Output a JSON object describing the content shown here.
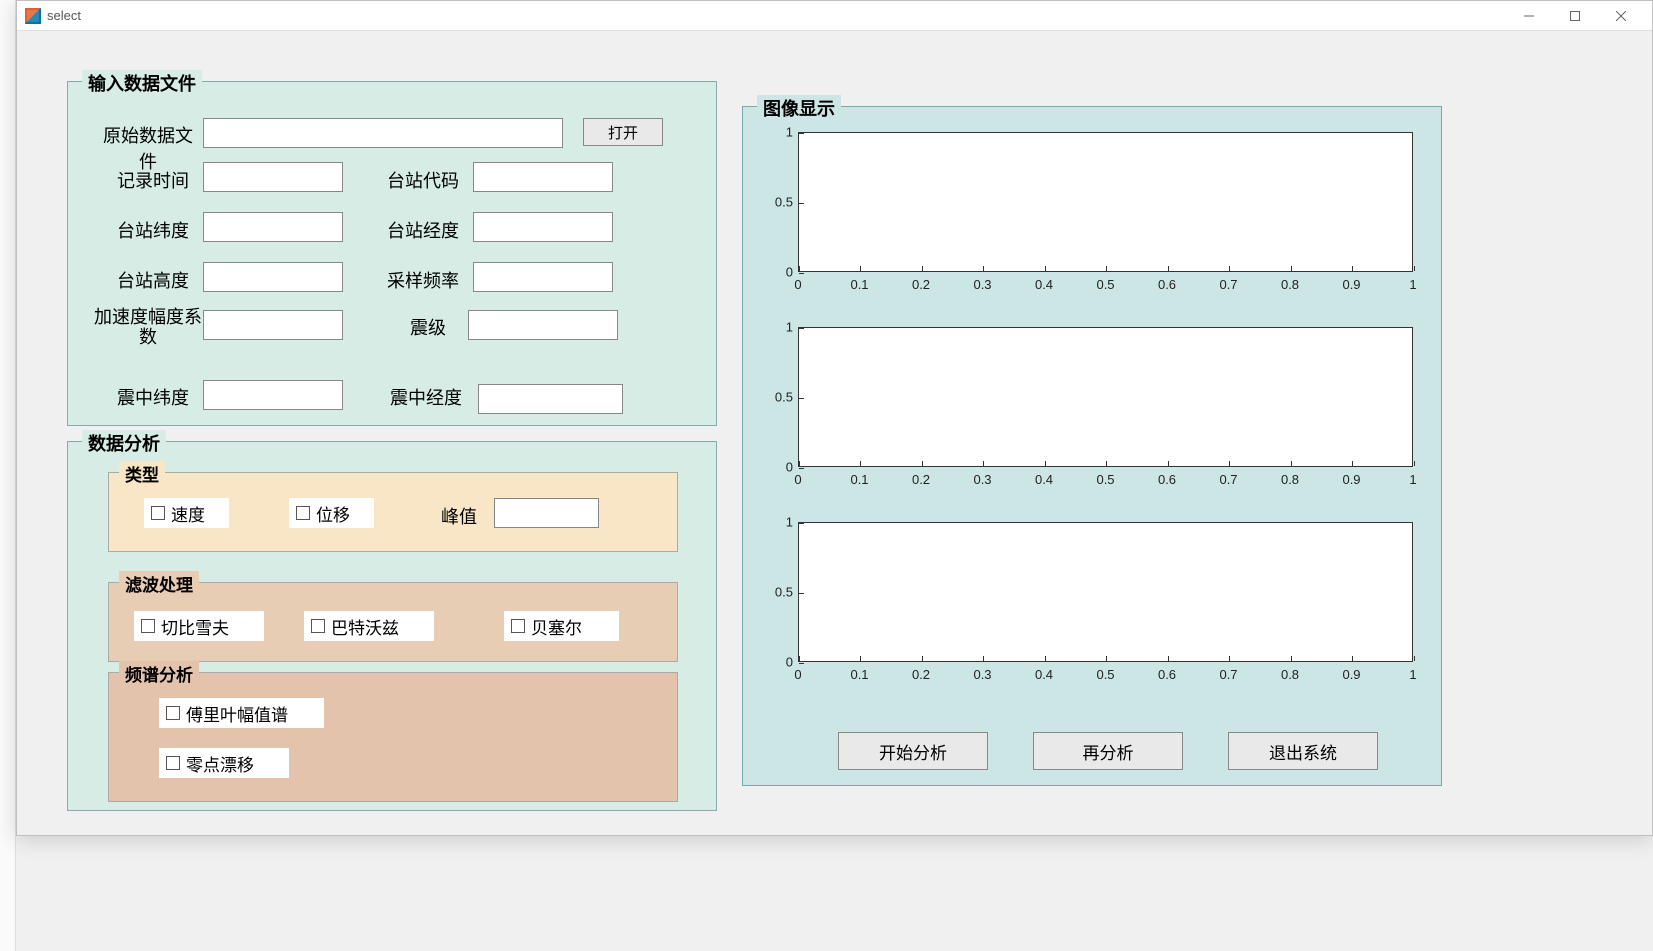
{
  "window": {
    "title": "select"
  },
  "panels": {
    "input_legend": "输入数据文件",
    "analysis_legend": "数据分析",
    "image_legend": "图像显示"
  },
  "input": {
    "raw_file_label": "原始数据文件",
    "raw_file_value": "",
    "open_btn": "打开",
    "record_time_label": "记录时间",
    "record_time_value": "",
    "station_code_label": "台站代码",
    "station_code_value": "",
    "station_lat_label": "台站纬度",
    "station_lat_value": "",
    "station_lon_label": "台站经度",
    "station_lon_value": "",
    "station_alt_label": "台站高度",
    "station_alt_value": "",
    "sample_freq_label": "采样频率",
    "sample_freq_value": "",
    "accel_coef_label": "加速度幅度系数",
    "accel_coef_value": "",
    "magnitude_label": "震级",
    "magnitude_value": "",
    "epi_lat_label": "震中纬度",
    "epi_lat_value": "",
    "epi_lon_label": "震中经度",
    "epi_lon_value": ""
  },
  "analysis": {
    "type_legend": "类型",
    "chk_velocity": "速度",
    "chk_displacement": "位移",
    "peak_label": "峰值",
    "peak_value": "",
    "filter_legend": "滤波处理",
    "chk_chebyshev": "切比雪夫",
    "chk_butterworth": "巴特沃兹",
    "chk_bessel": "贝塞尔",
    "spectrum_legend": "频谱分析",
    "chk_fourier": "傅里叶幅值谱",
    "chk_zerodrift": "零点漂移"
  },
  "actions": {
    "start": "开始分析",
    "reanalyze": "再分析",
    "exit": "退出系统"
  },
  "chart_data": [
    {
      "type": "line",
      "series": [],
      "xlim": [
        0,
        1
      ],
      "ylim": [
        0,
        1
      ],
      "xticks": [
        0,
        0.1,
        0.2,
        0.3,
        0.4,
        0.5,
        0.6,
        0.7,
        0.8,
        0.9,
        1
      ],
      "yticks": [
        0,
        0.5,
        1
      ]
    },
    {
      "type": "line",
      "series": [],
      "xlim": [
        0,
        1
      ],
      "ylim": [
        0,
        1
      ],
      "xticks": [
        0,
        0.1,
        0.2,
        0.3,
        0.4,
        0.5,
        0.6,
        0.7,
        0.8,
        0.9,
        1
      ],
      "yticks": [
        0,
        0.5,
        1
      ]
    },
    {
      "type": "line",
      "series": [],
      "xlim": [
        0,
        1
      ],
      "ylim": [
        0,
        1
      ],
      "xticks": [
        0,
        0.1,
        0.2,
        0.3,
        0.4,
        0.5,
        0.6,
        0.7,
        0.8,
        0.9,
        1
      ],
      "yticks": [
        0,
        0.5,
        1
      ]
    }
  ]
}
